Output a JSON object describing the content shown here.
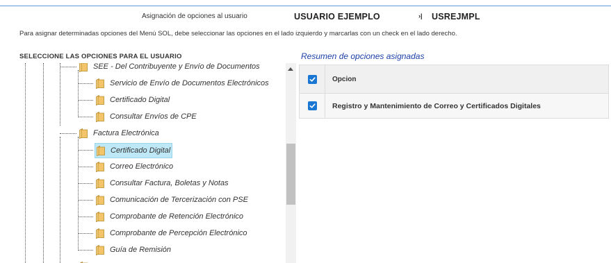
{
  "header": {
    "assign_label": "Asignación de opciones al usuario",
    "user_name": "USUARIO EJEMPLO",
    "separator": "›|",
    "user_code": "USREJMPL"
  },
  "instructions": "Para asignar determinadas opciones del Menú SOL, debe seleccionar las opciones en el lado izquierdo y marcarlas con un check en el lado derecho.",
  "tree": {
    "title": "SELECCIONE LAS OPCIONES PARA EL USUARIO",
    "nodes": [
      {
        "label": "SEE - Del Contribuyente y Envío de Documentos",
        "level": 1
      },
      {
        "label": "Servicio de Envío de Documentos Electrónicos",
        "level": 2
      },
      {
        "label": "Certificado Digital",
        "level": 2
      },
      {
        "label": "Consultar Envíos de CPE",
        "level": 2
      },
      {
        "label": "Factura Electrónica",
        "level": 1
      },
      {
        "label": "Certificado Digital",
        "level": 2,
        "selected": true
      },
      {
        "label": "Correo Electrónico",
        "level": 2
      },
      {
        "label": "Consultar Factura, Boletas y Notas",
        "level": 2
      },
      {
        "label": "Comunicación de Tercerización con PSE",
        "level": 2
      },
      {
        "label": "Comprobante de Retención Electrónico",
        "level": 2
      },
      {
        "label": "Comprobante de Percepción Electrónico",
        "level": 2
      },
      {
        "label": "Guía de Remisión",
        "level": 2
      }
    ]
  },
  "summary": {
    "title": "Resumen de opciones asignadas",
    "column_header": "Opcion",
    "header_checked": true,
    "rows": [
      {
        "label": "Registro y Mantenimiento de Correo y Certificados Digitales",
        "checked": true
      }
    ]
  },
  "colors": {
    "accent": "#1976d2",
    "link": "#1c3fa8",
    "selected_bg": "#bfe8f7",
    "folder": "#f2c56a"
  }
}
